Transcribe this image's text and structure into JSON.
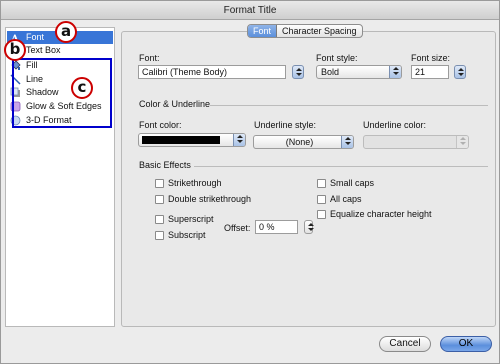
{
  "window": {
    "title": "Format Title"
  },
  "sidebar": {
    "items": [
      {
        "label": "Font",
        "icon": "font-icon",
        "selected": true
      },
      {
        "label": "Text Box",
        "icon": "text-box-icon"
      },
      {
        "label": "Fill",
        "icon": "paint-bucket-icon"
      },
      {
        "label": "Line",
        "icon": "line-icon"
      },
      {
        "label": "Shadow",
        "icon": "shadow-icon"
      },
      {
        "label": "Glow & Soft Edges",
        "icon": "glow-icon"
      },
      {
        "label": "3-D Format",
        "icon": "three-d-icon"
      }
    ]
  },
  "callouts": {
    "a": "a",
    "b": "b",
    "c": "c"
  },
  "tabs": [
    {
      "label": "Font",
      "active": true
    },
    {
      "label": "Character Spacing",
      "active": false
    }
  ],
  "font_section": {
    "font_label": "Font:",
    "font_value": "Calibri (Theme Body)",
    "style_label": "Font style:",
    "style_value": "Bold",
    "size_label": "Font size:",
    "size_value": "21"
  },
  "color_section": {
    "heading": "Color & Underline",
    "font_color_label": "Font color:",
    "font_color": "#000000",
    "underline_style_label": "Underline style:",
    "underline_style_value": "(None)",
    "underline_color_label": "Underline color:",
    "underline_color_value": ""
  },
  "effects": {
    "heading": "Basic Effects",
    "strikethrough": "Strikethrough",
    "double_strikethrough": "Double strikethrough",
    "superscript": "Superscript",
    "subscript": "Subscript",
    "small_caps": "Small caps",
    "all_caps": "All caps",
    "equalize": "Equalize character height",
    "offset_label": "Offset:",
    "offset_value": "0 %"
  },
  "buttons": {
    "cancel": "Cancel",
    "ok": "OK"
  },
  "colors": {
    "selection": "#3875d7",
    "callout_border": "#cc0000",
    "highlight_box": "#0000cc"
  }
}
